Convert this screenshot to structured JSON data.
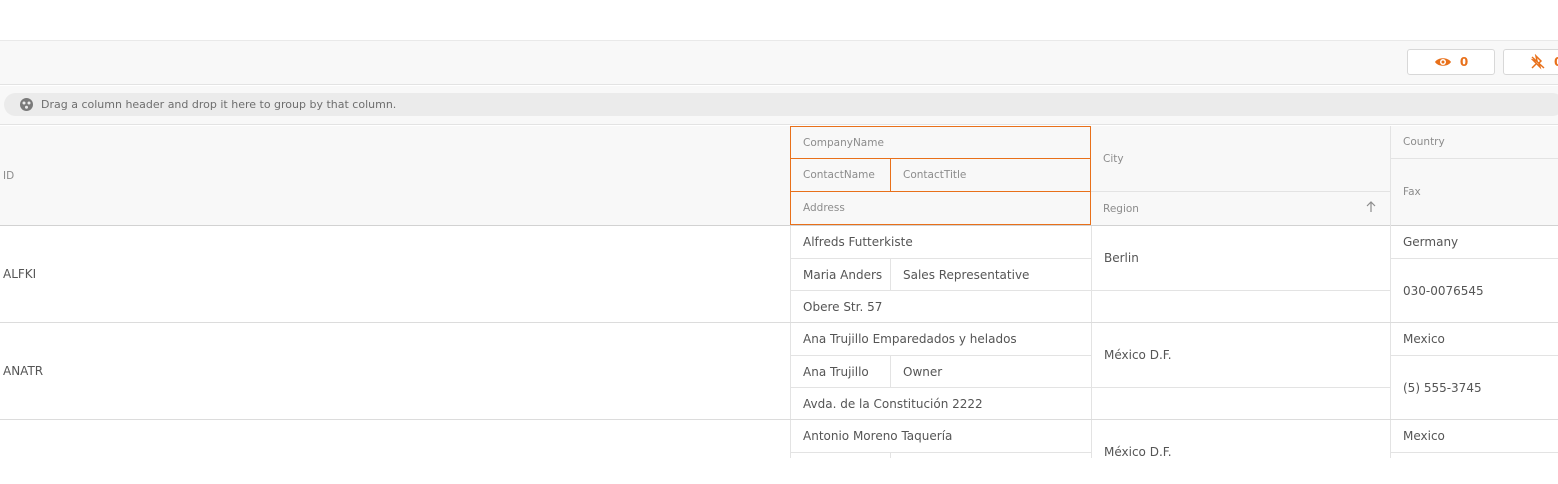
{
  "toolbar": {
    "hidden_columns_count": "0",
    "pinned_columns_count": "0"
  },
  "group_panel": {
    "hint": "Drag a column header and drop it here to group by that column."
  },
  "headers": {
    "id": "ID",
    "company_name": "CompanyName",
    "contact_name": "ContactName",
    "contact_title": "ContactTitle",
    "address": "Address",
    "city": "City",
    "region": "Region",
    "country": "Country",
    "fax": "Fax",
    "region_sort": "ascending"
  },
  "rows": [
    {
      "id": "ALFKI",
      "company_name": "Alfreds Futterkiste",
      "contact_name": "Maria Anders",
      "contact_title": "Sales Representative",
      "address": "Obere Str. 57",
      "city": "Berlin",
      "region": "",
      "country": "Germany",
      "fax": "030-0076545"
    },
    {
      "id": "ANATR",
      "company_name": "Ana Trujillo Emparedados y helados",
      "contact_name": "Ana Trujillo",
      "contact_title": "Owner",
      "address": "Avda. de la Constitución 2222",
      "city": "México D.F.",
      "region": "",
      "country": "Mexico",
      "fax": "(5) 555-3745"
    },
    {
      "id": "",
      "company_name": "Antonio Moreno Taquería",
      "city": "México D.F.",
      "country": "Mexico"
    }
  ],
  "colors": {
    "accent": "#e8701a",
    "header_bg": "#f8f8f8",
    "border": "#e3e3e3"
  }
}
